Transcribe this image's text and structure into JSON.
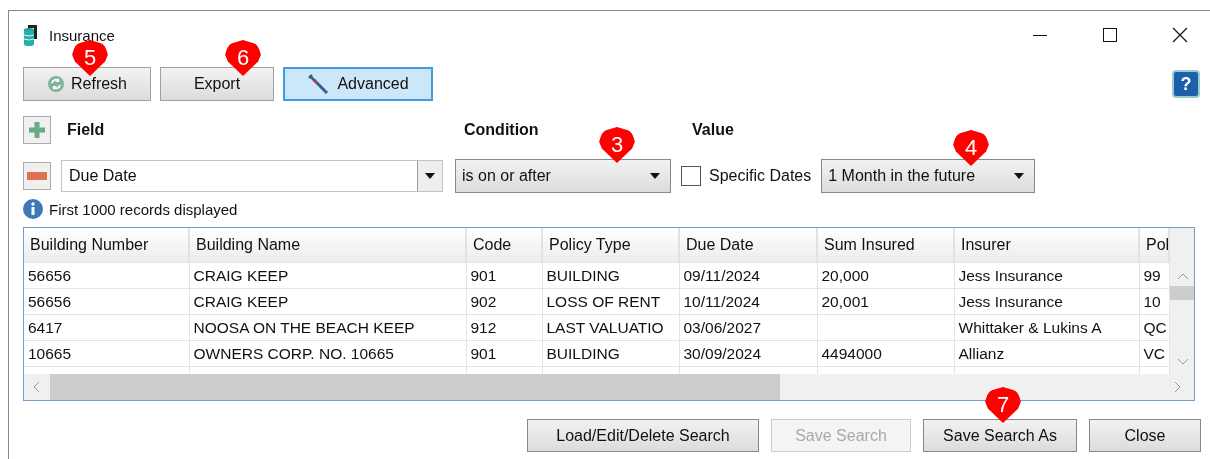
{
  "window": {
    "title": "Insurance"
  },
  "toolbar": [
    {
      "label": "Refresh",
      "kind": "refresh",
      "selected": false
    },
    {
      "label": "Export",
      "kind": "plain",
      "selected": false
    },
    {
      "label": "Advanced",
      "kind": "advanced",
      "selected": true
    }
  ],
  "help_button": "?",
  "filter": {
    "headers": {
      "field": "Field",
      "condition": "Condition",
      "value": "Value"
    },
    "field_value": "Due Date",
    "condition_value": "is on or after",
    "specific_dates": {
      "label": "Specific Dates",
      "checked": false
    },
    "value_dropdown": "1 Month in the future"
  },
  "info": "First 1000 records displayed",
  "table": {
    "columns": [
      "Building Number",
      "Building Name",
      "Code",
      "Policy Type",
      "Due Date",
      "Sum Insured",
      "Insurer",
      "Pol"
    ],
    "rows": [
      [
        "56656",
        "CRAIG KEEP",
        "901",
        "BUILDING",
        "09/11/2024",
        "20,000",
        "Jess Insurance",
        "99"
      ],
      [
        "56656",
        "CRAIG KEEP",
        "902",
        "LOSS OF RENT",
        "10/11/2024",
        "20,001",
        "Jess Insurance",
        "10"
      ],
      [
        "6417",
        "NOOSA ON THE BEACH KEEP",
        "912",
        "LAST VALUATIO",
        "03/06/2027",
        "",
        "Whittaker & Lukins A",
        "QC"
      ],
      [
        "10665",
        "OWNERS CORP. NO. 10665",
        "901",
        "BUILDING",
        "30/09/2024",
        "4494000",
        "Allianz",
        "VC"
      ]
    ]
  },
  "footer_buttons": [
    {
      "label": "Load/Edit/Delete Search",
      "disabled": false
    },
    {
      "label": "Save Search",
      "disabled": true
    },
    {
      "label": "Save Search As",
      "disabled": false
    },
    {
      "label": "Close",
      "disabled": false
    }
  ],
  "callouts": [
    {
      "label": "5"
    },
    {
      "label": "6"
    },
    {
      "label": "3"
    },
    {
      "label": "4"
    },
    {
      "label": "7"
    }
  ]
}
